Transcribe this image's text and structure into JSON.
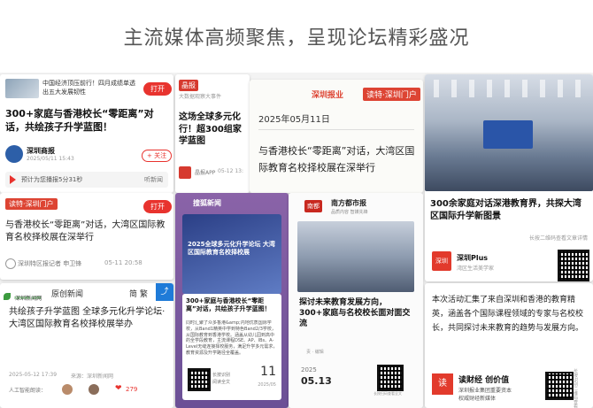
{
  "header": {
    "title": "主流媒体高频聚焦，呈现论坛精彩盛况"
  },
  "card1": {
    "top_line1": "中国经济顶压前行！四月成绩单透",
    "top_line2": "出五大发展韧性",
    "open_btn": "打开",
    "headline": "300+家庭与香港校长“零距离”对话，共绘孩子升学蓝图！",
    "source_name": "深圳商报",
    "source_time": "2025/05/11 15:43",
    "follow_btn": "+ 关注",
    "audio_text": "预计为您播报5分31秒",
    "listen_text": "听新闻"
  },
  "card2": {
    "logo": "晶报",
    "top_line": "大数据观察大事件",
    "open_btn": "打开",
    "headline": "这场全球多元化行！超300组家学蓝图",
    "source": "晶报APP",
    "time": "05-12 13:",
    "follow": "关"
  },
  "card3": {
    "brand": "深圳报业",
    "brand2": "读特·深圳门户",
    "date": "2025年05月11日",
    "headline": "与香港校长“零距离”对话，大湾区国际教育名校择校展在深举行"
  },
  "card4": {
    "headline": "300余家庭对话深港教育界，共探大湾区国际升学新图景",
    "note": "长按二维码查看文章详情",
    "brand": "深圳Plus",
    "sub": "湾区生活美学家",
    "logo": "深圳"
  },
  "card5": {
    "logo": "读特·深圳门户",
    "open_btn": "打开",
    "headline": "与香港校长“零距离”对话，大湾区国际教育名校择校展在深举行",
    "author": "深圳特区报记者 申卫锋",
    "time": "05-11 20:58"
  },
  "card6": {
    "brand": "搜狐新闻",
    "poster_title": "2025全球多元化升学论坛 大湾区国际教育名校择校展",
    "headline": "300+家庭与香港校长“零距离”对话，共绘孩子升学蓝图！",
    "body": "同时汇聚了众多香港&amp;内地优质国际学校，从Band1精英中学到特色Band2/3学校，从国际教育到香港学校。涵盖从幼儿园到高中的全学段教育，主流课程DSE、AP、IBs、A-Level无缝连接择校服务，满足升学多元需求，教育资源及升学路径全覆盖。",
    "read": "长按识别",
    "read2": "阅读全文",
    "date_day": "11",
    "date_month": "2025/05"
  },
  "card7": {
    "logo": "南都",
    "brand": "南方都市报",
    "slogan": "品质内容 智媒先锋",
    "headline": "探讨未来教育发展方向，300+家庭与名校校长面对面交流",
    "meta": "责 · 编辑",
    "date": "2025",
    "date2": "05.13",
    "scan": "长按扫码查看全文"
  },
  "card8": {
    "brand": "深圳新闻网",
    "brand_en": "sznews.com",
    "site": "原创新闻",
    "lang": "简 繁",
    "headline": "共绘孩子升学蓝图 全球多元化升学论坛·大湾区国际教育名校择校展举办",
    "time": "2025-05-12 17:39",
    "source": "来源：深圳新闻网",
    "listen": "人工智能朗读：",
    "likes": "279"
  },
  "card9": {
    "body": "本次活动汇集了来自深圳和香港的教育精英，涵盖各个国际课程领域的专家与名校校长，共同探讨未来教育的趋势与发展方向。",
    "logo": "读",
    "brand": "读财经 创价值",
    "sub": "深圳报业集团重要资本",
    "sub2": "权威财经新媒体",
    "side": "长按识别二维码查看全文"
  }
}
